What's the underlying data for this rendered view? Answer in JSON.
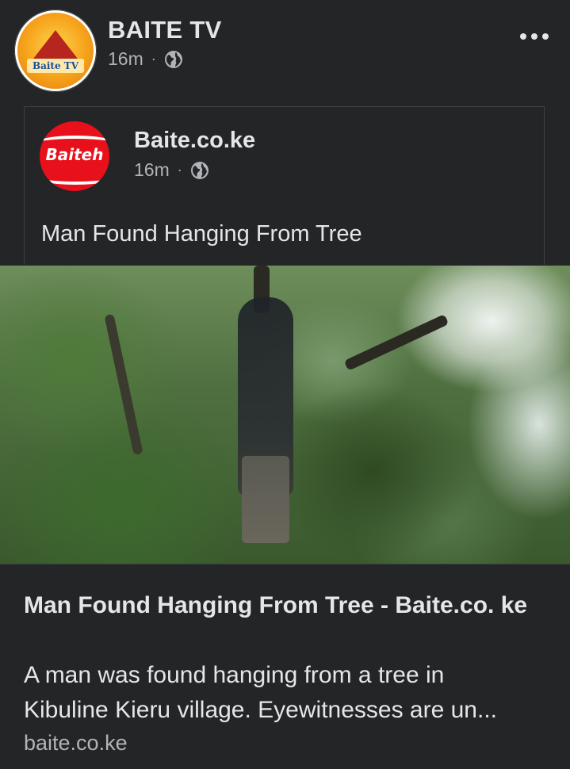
{
  "post": {
    "page_name": "BAITE TV",
    "avatar_label": "Baite TV",
    "time": "16m",
    "separator": "·",
    "privacy_icon": "globe-icon",
    "menu_icon": "more-horizontal-icon"
  },
  "shared_post": {
    "page_name": "Baite.co.ke",
    "avatar_label": "Baiteh",
    "time": "16m",
    "separator": "·",
    "privacy_icon": "globe-icon",
    "text": "Man Found Hanging From Tree"
  },
  "link_preview": {
    "title": "Man Found Hanging From Tree - Baite.co. ke",
    "description_line1": "A man was found hanging from a tree in",
    "description_line2": "Kibuline Kieru village. Eyewitnesses are un...",
    "domain": "baite.co.ke"
  },
  "colors": {
    "background": "#242526",
    "text_primary": "#e4e6eb",
    "text_secondary": "#b0b3b8",
    "border": "#3e4042",
    "baite_tv_brand": "#f6a21a",
    "baite_brand": "#e8101a"
  }
}
